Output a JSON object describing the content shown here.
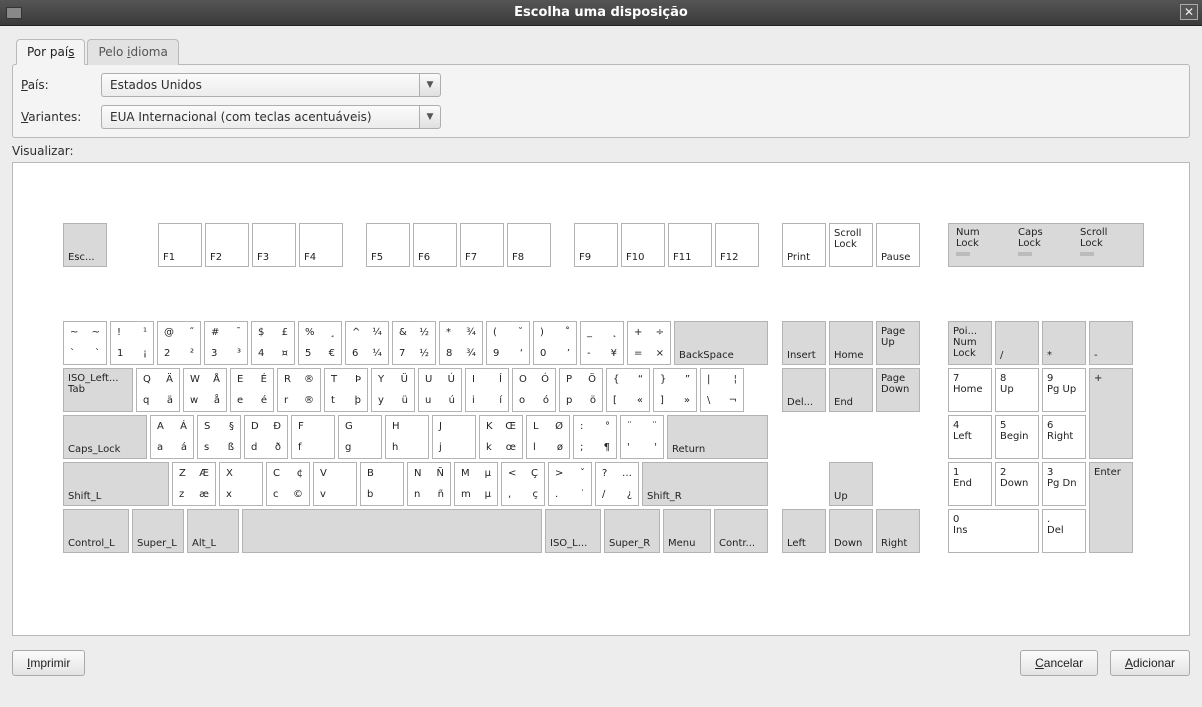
{
  "titlebar": {
    "title": "Escolha uma disposição"
  },
  "tabs": {
    "by_country": {
      "pre": "Por paí",
      "ul": "s"
    },
    "by_language": {
      "pre": "Pelo ",
      "ul": "i",
      "post": "dioma"
    }
  },
  "form": {
    "country_label": {
      "ul": "P",
      "post": "aís:"
    },
    "country_value": "Estados Unidos",
    "variant_label": {
      "ul": "V",
      "post": "ariantes:"
    },
    "variant_value": "EUA Internacional (com teclas acentuáveis)",
    "preview_label": "Visualizar:"
  },
  "buttons": {
    "print": {
      "ul": "I",
      "post": "mprimir"
    },
    "cancel": {
      "ul": "C",
      "post": "ancelar"
    },
    "add": {
      "ul": "A",
      "post": "dicionar"
    }
  },
  "locks": {
    "num": "Num\nLock",
    "caps": "Caps\nLock",
    "scroll": "Scroll\nLock"
  },
  "fnkeys": {
    "esc": "Esc...",
    "f1": "F1",
    "f2": "F2",
    "f3": "F3",
    "f4": "F4",
    "f5": "F5",
    "f6": "F6",
    "f7": "F7",
    "f8": "F8",
    "f9": "F9",
    "f10": "F10",
    "f11": "F11",
    "f12": "F12",
    "print": "Print",
    "scroll": "Scroll\nLock",
    "pause": "Pause"
  },
  "row1": {
    "k1": {
      "tl": "~",
      "tr": "~",
      "bl": "`",
      "br": "`"
    },
    "k2": {
      "tl": "!",
      "tr": "¹",
      "bl": "1",
      "br": "¡"
    },
    "k3": {
      "tl": "@",
      "tr": "˝",
      "bl": "2",
      "br": "²"
    },
    "k4": {
      "tl": "#",
      "tr": "¯",
      "bl": "3",
      "br": "³"
    },
    "k5": {
      "tl": "$",
      "tr": "£",
      "bl": "4",
      "br": "¤"
    },
    "k6": {
      "tl": "%",
      "tr": "¸",
      "bl": "5",
      "br": "€"
    },
    "k7": {
      "tl": "^",
      "tr": "¼",
      "bl": "6",
      "br": "¼"
    },
    "k8": {
      "tl": "&",
      "tr": "½",
      "bl": "7",
      "br": "½"
    },
    "k9": {
      "tl": "*",
      "tr": "¾",
      "bl": "8",
      "br": "¾"
    },
    "k10": {
      "tl": "(",
      "tr": "˘",
      "bl": "9",
      "br": "‘"
    },
    "k11": {
      "tl": ")",
      "tr": "˚",
      "bl": "0",
      "br": "’"
    },
    "k12": {
      "tl": "_",
      "tr": "˛",
      "bl": "-",
      "br": "¥"
    },
    "k13": {
      "tl": "+",
      "tr": "÷",
      "bl": "=",
      "br": "×"
    },
    "backspace": "BackSpace"
  },
  "row2": {
    "tab": "ISO_Left...\nTab",
    "k1": {
      "tl": "Q",
      "tr": "Ä",
      "bl": "q",
      "br": "ä"
    },
    "k2": {
      "tl": "W",
      "tr": "Å",
      "bl": "w",
      "br": "å"
    },
    "k3": {
      "tl": "E",
      "tr": "É",
      "bl": "e",
      "br": "é"
    },
    "k4": {
      "tl": "R",
      "tr": "®",
      "bl": "r",
      "br": "®"
    },
    "k5": {
      "tl": "T",
      "tr": "Þ",
      "bl": "t",
      "br": "þ"
    },
    "k6": {
      "tl": "Y",
      "tr": "Ü",
      "bl": "y",
      "br": "ü"
    },
    "k7": {
      "tl": "U",
      "tr": "Ú",
      "bl": "u",
      "br": "ú"
    },
    "k8": {
      "tl": "I",
      "tr": "Í",
      "bl": "i",
      "br": "í"
    },
    "k9": {
      "tl": "O",
      "tr": "Ó",
      "bl": "o",
      "br": "ó"
    },
    "k10": {
      "tl": "P",
      "tr": "Ö",
      "bl": "p",
      "br": "ö"
    },
    "k11": {
      "tl": "{",
      "tr": "“",
      "bl": "[",
      "br": "«"
    },
    "k12": {
      "tl": "}",
      "tr": "”",
      "bl": "]",
      "br": "»"
    },
    "k13": {
      "tl": "|",
      "tr": "¦",
      "bl": "\\",
      "br": "¬"
    }
  },
  "row3": {
    "caps": "Caps_Lock",
    "k1": {
      "tl": "A",
      "tr": "Á",
      "bl": "a",
      "br": "á"
    },
    "k2": {
      "tl": "S",
      "tr": "§",
      "bl": "s",
      "br": "ß"
    },
    "k3": {
      "tl": "D",
      "tr": "Ð",
      "bl": "d",
      "br": "ð"
    },
    "k4": {
      "tl": "F",
      "tr": "",
      "bl": "f",
      "br": ""
    },
    "k5": {
      "tl": "G",
      "tr": "",
      "bl": "g",
      "br": ""
    },
    "k6": {
      "tl": "H",
      "tr": "",
      "bl": "h",
      "br": ""
    },
    "k7": {
      "tl": "J",
      "tr": "",
      "bl": "j",
      "br": ""
    },
    "k8": {
      "tl": "K",
      "tr": "Œ",
      "bl": "k",
      "br": "œ"
    },
    "k9": {
      "tl": "L",
      "tr": "Ø",
      "bl": "l",
      "br": "ø"
    },
    "k10": {
      "tl": ":",
      "tr": "°",
      "bl": ";",
      "br": "¶"
    },
    "k11": {
      "tl": "¨",
      "tr": "¨",
      "bl": "'",
      "br": "'"
    },
    "return": "Return"
  },
  "row4": {
    "shiftl": "Shift_L",
    "k1": {
      "tl": "Z",
      "tr": "Æ",
      "bl": "z",
      "br": "æ"
    },
    "k2": {
      "tl": "X",
      "tr": "",
      "bl": "x",
      "br": ""
    },
    "k3": {
      "tl": "C",
      "tr": "¢",
      "bl": "c",
      "br": "©"
    },
    "k4": {
      "tl": "V",
      "tr": "",
      "bl": "v",
      "br": ""
    },
    "k5": {
      "tl": "B",
      "tr": "",
      "bl": "b",
      "br": ""
    },
    "k6": {
      "tl": "N",
      "tr": "Ñ",
      "bl": "n",
      "br": "ñ"
    },
    "k7": {
      "tl": "M",
      "tr": "µ",
      "bl": "m",
      "br": "µ"
    },
    "k8": {
      "tl": "<",
      "tr": "Ç",
      "bl": ",",
      "br": "ç"
    },
    "k9": {
      "tl": ">",
      "tr": "ˇ",
      "bl": ".",
      "br": "˙"
    },
    "k10": {
      "tl": "?",
      "tr": "…",
      "bl": "/",
      "br": "¿"
    },
    "shiftr": "Shift_R"
  },
  "row5": {
    "ctrll": "Control_L",
    "superl": "Super_L",
    "altl": "Alt_L",
    "isol": "ISO_L...",
    "superr": "Super_R",
    "menu": "Menu",
    "ctrlr": "Contr..."
  },
  "nav": {
    "insert": "Insert",
    "home": "Home",
    "pgup": "Page\nUp",
    "del": "Del...",
    "end": "End",
    "pgdn": "Page\nDown",
    "up": "Up",
    "left": "Left",
    "down": "Down",
    "right": "Right"
  },
  "numpad": {
    "numlock": "Poi...\nNum\nLock",
    "div": "/",
    "mul": "*",
    "sub": "-",
    "k7": "7\nHome",
    "k8": "8\nUp",
    "k9": "9\nPg Up",
    "add": "+",
    "k4": "4\nLeft",
    "k5": "5\nBegin",
    "k6": "6\nRight",
    "k1": "1\nEnd",
    "k2": "2\nDown",
    "k3": "3\nPg Dn",
    "enter": "Enter",
    "k0": "0\nIns",
    "dot": ".\nDel"
  }
}
